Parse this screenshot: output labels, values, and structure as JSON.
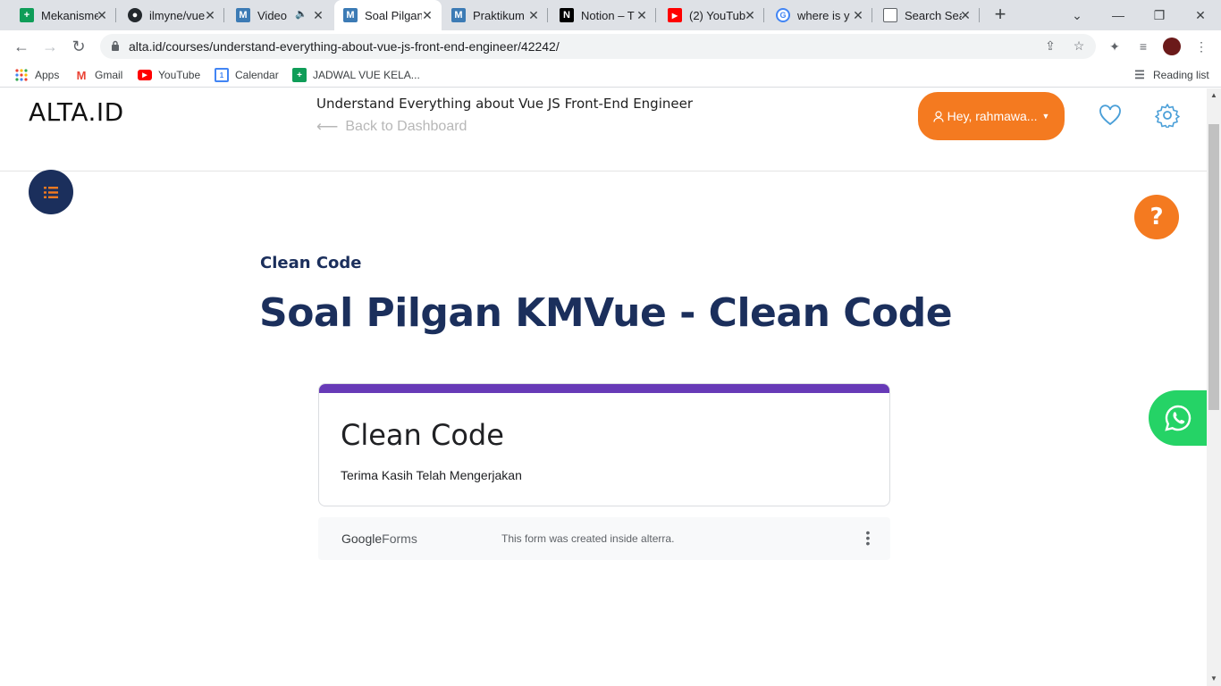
{
  "browser": {
    "tabs": [
      {
        "title": "Mekanisme",
        "favicon": "google-sheets-icon",
        "color": "#0f9d58"
      },
      {
        "title": "ilmyne/vue",
        "favicon": "github-icon",
        "color": "#24292e"
      },
      {
        "title": "Video",
        "favicon": "alta-m-icon",
        "color": "#3c7bb5",
        "muted": true
      },
      {
        "title": "Soal Pilgan",
        "favicon": "alta-m-icon",
        "color": "#3c7bb5",
        "active": true
      },
      {
        "title": "Praktikum",
        "favicon": "alta-m-icon",
        "color": "#3c7bb5"
      },
      {
        "title": "Notion – T",
        "favicon": "notion-icon",
        "color": "#000000"
      },
      {
        "title": "(2) YouTub",
        "favicon": "youtube-icon",
        "color": "#ff0000"
      },
      {
        "title": "where is y",
        "favicon": "google-icon",
        "color": "#4285f4"
      },
      {
        "title": "Search Sea",
        "favicon": "page-icon",
        "color": "#5f6368"
      }
    ],
    "address": "alta.id/courses/understand-everything-about-vue-js-front-end-engineer/42242/",
    "bookmarks": [
      {
        "label": "Apps",
        "icon": "apps-grid-icon"
      },
      {
        "label": "Gmail",
        "icon": "gmail-icon"
      },
      {
        "label": "YouTube",
        "icon": "youtube-icon"
      },
      {
        "label": "Calendar",
        "icon": "calendar-icon"
      },
      {
        "label": "JADWAL VUE KELA...",
        "icon": "google-sheets-icon"
      }
    ],
    "reading_list": "Reading list"
  },
  "site": {
    "logo": "ALTA.ID",
    "course_title": "Understand Everything about Vue JS Front-End Engineer",
    "back_link": "Back to Dashboard",
    "user_button": "Hey, rahmawa...",
    "accent": "#f47a20",
    "navy": "#1b2f5c"
  },
  "lesson": {
    "section": "Clean Code",
    "title": "Soal Pilgan KMVue - Clean Code"
  },
  "form": {
    "title": "Clean Code",
    "message": "Terima Kasih Telah Mengerjakan",
    "brand_google": "Google",
    "brand_forms": "Forms",
    "note": "This form was created inside alterra.",
    "accent": "#673ab7"
  }
}
